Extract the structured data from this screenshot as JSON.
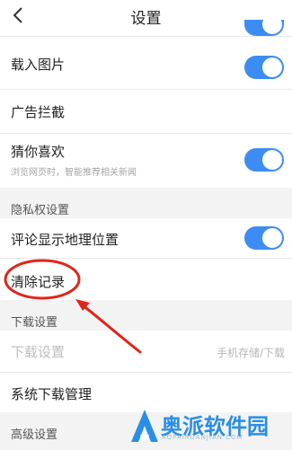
{
  "header": {
    "title": "设置",
    "back_icon": "chevron-left-icon"
  },
  "rows": {
    "load_images": {
      "label": "载入图片",
      "toggle_on": true
    },
    "ad_block": {
      "label": "广告拦截"
    },
    "guess": {
      "label": "猜你喜欢",
      "sub": "浏览网页时，智能推荐相关新闻",
      "toggle_on": true
    }
  },
  "sections": {
    "privacy": "隐私权设置",
    "download": "下载设置",
    "advanced": "高级设置"
  },
  "privacy": {
    "comment_location": {
      "label": "评论显示地理位置",
      "toggle_on": true
    },
    "clear_records": {
      "label": "清除记录"
    }
  },
  "download": {
    "settings": {
      "label": "下载设置",
      "value": "手机存储/下载"
    },
    "system_manager": {
      "label": "系统下载管理"
    }
  },
  "watermark": {
    "text": "奥派软件园",
    "sub": "AOPAIRUANJIAN.COM"
  },
  "colors": {
    "accent": "#3d8cf4",
    "annotation": "#e0251b",
    "section_bg": "#f3f3f3"
  }
}
